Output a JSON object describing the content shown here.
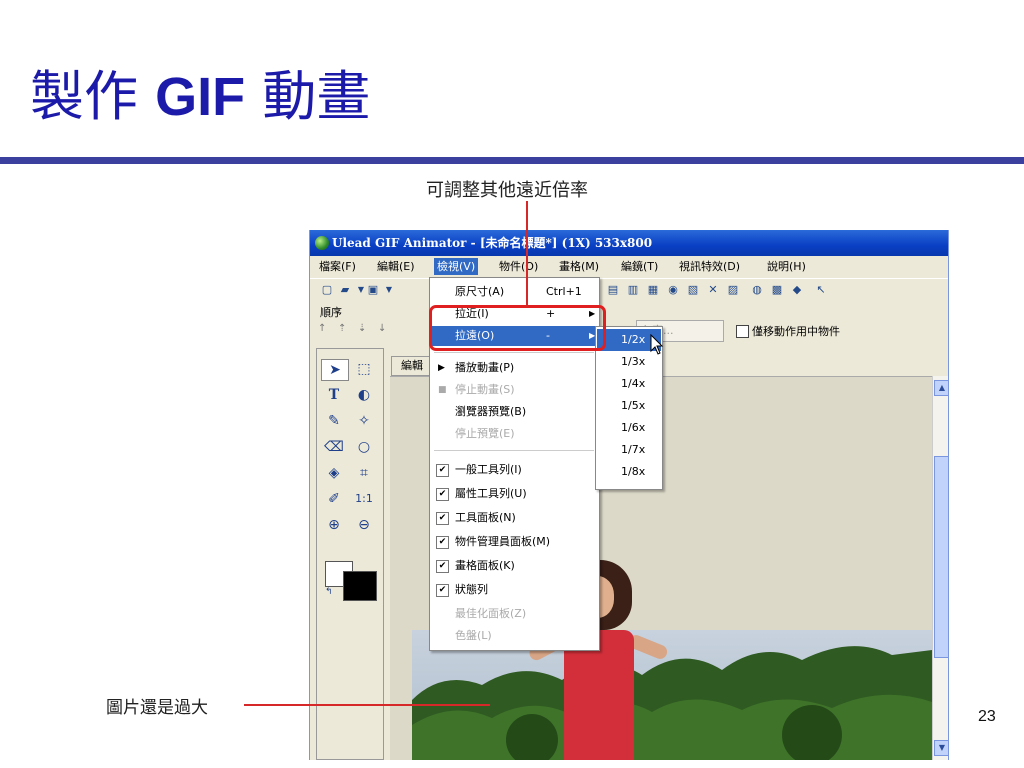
{
  "slide": {
    "title_pre": "製作 ",
    "title_gif": "GIF",
    "title_post": " 動畫",
    "callout_top": "可調整其他遠近倍率",
    "callout_bottom": "圖片還是過大",
    "page_number": "23",
    "accent_color": "#1c1aa8",
    "callout_color": "#d62828"
  },
  "app": {
    "window_title": "Ulead GIF Animator - [未命名標題*] (1X) 533x800",
    "menus": [
      "檔案(F)",
      "編輯(E)",
      "檢視(V)",
      "物件(O)",
      "畫格(M)",
      "編鏡(T)",
      "視訊特效(D)",
      "說明(H)"
    ],
    "active_menu_index": 2,
    "sequence_label": "順序",
    "content_button": "內容...",
    "checkbox_label": "僅移動作用中物件",
    "edit_tab": "編輯"
  },
  "view_menu": {
    "items": [
      {
        "label": "原尺寸(A)",
        "shortcut": "Ctrl+1"
      },
      {
        "label": "拉近(I)",
        "shortcut": "+",
        "submenu": true
      },
      {
        "label": "拉遠(O)",
        "shortcut": "-",
        "submenu": true,
        "active": true
      },
      {
        "label": "播放動畫(P)",
        "glyph": "▶"
      },
      {
        "label": "停止動畫(S)",
        "glyph": "■",
        "disabled": true
      },
      {
        "label": "瀏覽器預覽(B)"
      },
      {
        "label": "停止預覽(E)",
        "disabled": true
      },
      {
        "label": "一般工具列(I)",
        "checked": true
      },
      {
        "label": "屬性工具列(U)",
        "checked": true
      },
      {
        "label": "工具面板(N)",
        "checked": true
      },
      {
        "label": "物件管理員面板(M)",
        "checked": true
      },
      {
        "label": "畫格面板(K)",
        "checked": true
      },
      {
        "label": "狀態列",
        "checked": true
      },
      {
        "label": "最佳化面板(Z)",
        "disabled": true
      },
      {
        "label": "色盤(L)",
        "disabled": true
      }
    ]
  },
  "zoom_out_submenu": {
    "items": [
      "1/2x",
      "1/3x",
      "1/4x",
      "1/5x",
      "1/6x",
      "1/7x",
      "1/8x"
    ],
    "active_index": 0
  }
}
